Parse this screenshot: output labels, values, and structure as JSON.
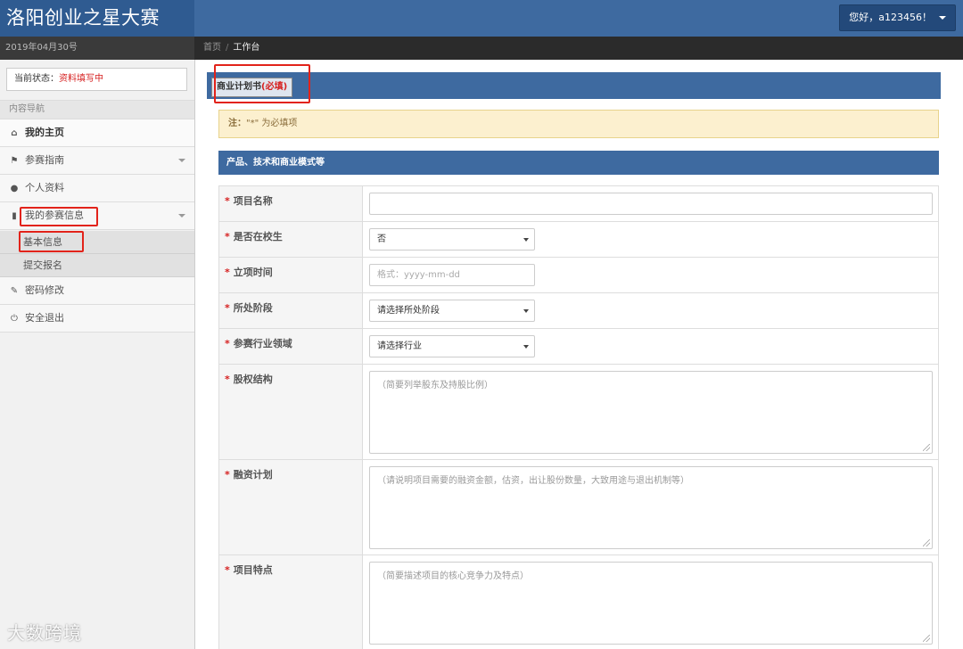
{
  "header": {
    "brand": "洛阳创业之星大赛",
    "user_label": "您好，a123456！"
  },
  "subbar": {
    "date": "2019年04月30号",
    "breadcrumb_home": "首页",
    "breadcrumb_sep": "/",
    "breadcrumb_current": "工作台"
  },
  "sidebar": {
    "status_label": "当前状态：",
    "status_value": "资料填写中",
    "nav_heading": "内容导航",
    "items": [
      {
        "label": "我的主页",
        "icon": "home-icon"
      },
      {
        "label": "参赛指南",
        "icon": "flag-icon"
      },
      {
        "label": "个人资料",
        "icon": "user-icon"
      },
      {
        "label": "我的参赛信息",
        "icon": "file-icon"
      },
      {
        "label": "基本信息"
      },
      {
        "label": "提交报名"
      },
      {
        "label": "密码修改",
        "icon": "wrench-icon"
      },
      {
        "label": "安全退出",
        "icon": "power-icon"
      }
    ]
  },
  "main": {
    "panel_tab": "商业计划书",
    "panel_tab_required": "(必填)",
    "note_label": "注：",
    "note_text": "\"*\" 为必填项",
    "section_title": "产品、技术和商业模式等",
    "fields": {
      "name": {
        "label": "项目名称",
        "value": ""
      },
      "in_school": {
        "label": "是否在校生",
        "value": "否"
      },
      "start_date": {
        "label": "立项时间",
        "placeholder": "格式：yyyy-mm-dd"
      },
      "stage": {
        "label": "所处阶段",
        "value": "请选择所处阶段"
      },
      "industry": {
        "label": "参赛行业领域",
        "value": "请选择行业"
      },
      "equity": {
        "label": "股权结构",
        "placeholder": "（简要列举股东及持股比例）"
      },
      "financing": {
        "label": "融资计划",
        "placeholder": "（请说明项目需要的融资金额，估资，出让股份数量，大致用途与退出机制等）"
      },
      "features": {
        "label": "项目特点",
        "placeholder": "（简要描述项目的核心竞争力及特点）"
      }
    },
    "required_mark": "*"
  },
  "watermark": "大数跨境",
  "colors": {
    "header_blue": "#3e6aa0",
    "brand_blue": "#2f5b91",
    "required_red": "#d62020",
    "highlight_red": "#e2231a",
    "note_bg": "#fcf0cf"
  }
}
